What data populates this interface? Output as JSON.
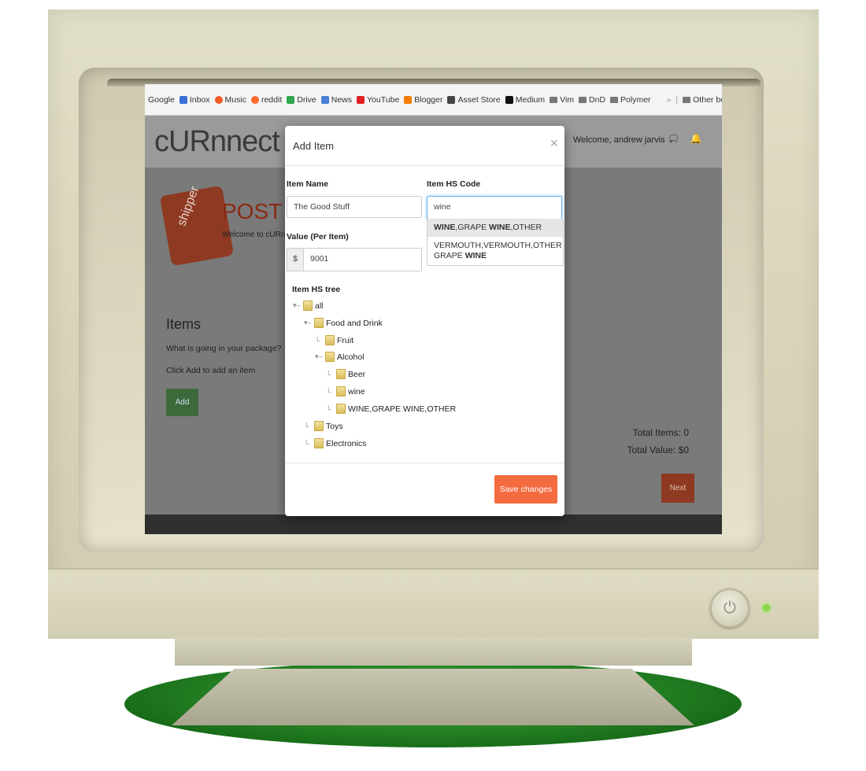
{
  "browser": {
    "bookmarks": [
      {
        "label": "Google",
        "icon": "none",
        "color": "#f4f4f4"
      },
      {
        "label": "Inbox",
        "icon": "inbox-icon",
        "color": "#3b6fd8"
      },
      {
        "label": "Music",
        "icon": "music-icon",
        "color": "#f25a22"
      },
      {
        "label": "reddit",
        "icon": "reddit-icon",
        "color": "#ff6a32"
      },
      {
        "label": "Drive",
        "icon": "drive-icon",
        "color": "#2fa84f"
      },
      {
        "label": "News",
        "icon": "news-icon",
        "color": "#4a7fd8"
      },
      {
        "label": "YouTube",
        "icon": "youtube-icon",
        "color": "#e02020"
      },
      {
        "label": "Blogger",
        "icon": "blogger-icon",
        "color": "#f57c00"
      },
      {
        "label": "Asset Store",
        "icon": "unity-icon",
        "color": "#444444"
      },
      {
        "label": "Medium",
        "icon": "medium-icon",
        "color": "#111111"
      },
      {
        "label": "Vim",
        "icon": "folder-icon",
        "color": "#777777"
      },
      {
        "label": "DnD",
        "icon": "folder-icon",
        "color": "#777777"
      },
      {
        "label": "Polymer",
        "icon": "folder-icon",
        "color": "#777777"
      }
    ],
    "overflow": "»",
    "other_bookmarks": "Other bookmarks"
  },
  "app": {
    "logo": "cURnnect",
    "welcome": "Welcome,  andrew jarvis ⌄",
    "badge": "shipper",
    "post_title": "POST A",
    "post_sub": "Welcome to cURnne",
    "items_title": "Items",
    "items_question": "What is going in your package?",
    "items_hint": "Click Add to add an item",
    "add_label": "Add",
    "total_items": "Total Items: 0",
    "total_value": "Total Value: $0",
    "next_label": "Next"
  },
  "modal": {
    "title": "Add Item",
    "close": "×",
    "item_name_label": "Item Name",
    "item_name_value": "The Good Stuff",
    "hs_code_label": "Item HS Code",
    "hs_code_value": "wine",
    "value_label": "Value (Per Item)",
    "currency": "$",
    "value_value": "9001",
    "tree_label": "Item HS tree",
    "suggestions": [
      {
        "pre": "",
        "bold": "WINE",
        "mid": ",GRAPE ",
        "bold2": "WINE",
        "post": ",OTHER"
      },
      {
        "pre": "VERMOUTH,VERMOUTH,OTHER GRAPE ",
        "bold": "WINE",
        "mid": "",
        "bold2": "",
        "post": ""
      }
    ],
    "tree": [
      {
        "label": "all",
        "depth": 0
      },
      {
        "label": "Food and Drink",
        "depth": 1
      },
      {
        "label": "Fruit",
        "depth": 2
      },
      {
        "label": "Alcohol",
        "depth": 2
      },
      {
        "label": "Beer",
        "depth": 3
      },
      {
        "label": "wine",
        "depth": 3
      },
      {
        "label": "WINE,GRAPE WINE,OTHER",
        "depth": 3
      },
      {
        "label": "Toys",
        "depth": 1
      },
      {
        "label": "Electronics",
        "depth": 1
      }
    ],
    "save_label": "Save changes"
  },
  "colors": {
    "accent": "#f36b3f",
    "add_button": "#3e6a3b",
    "next_button": "#8e3a22",
    "power_led": "#8ad24a"
  }
}
